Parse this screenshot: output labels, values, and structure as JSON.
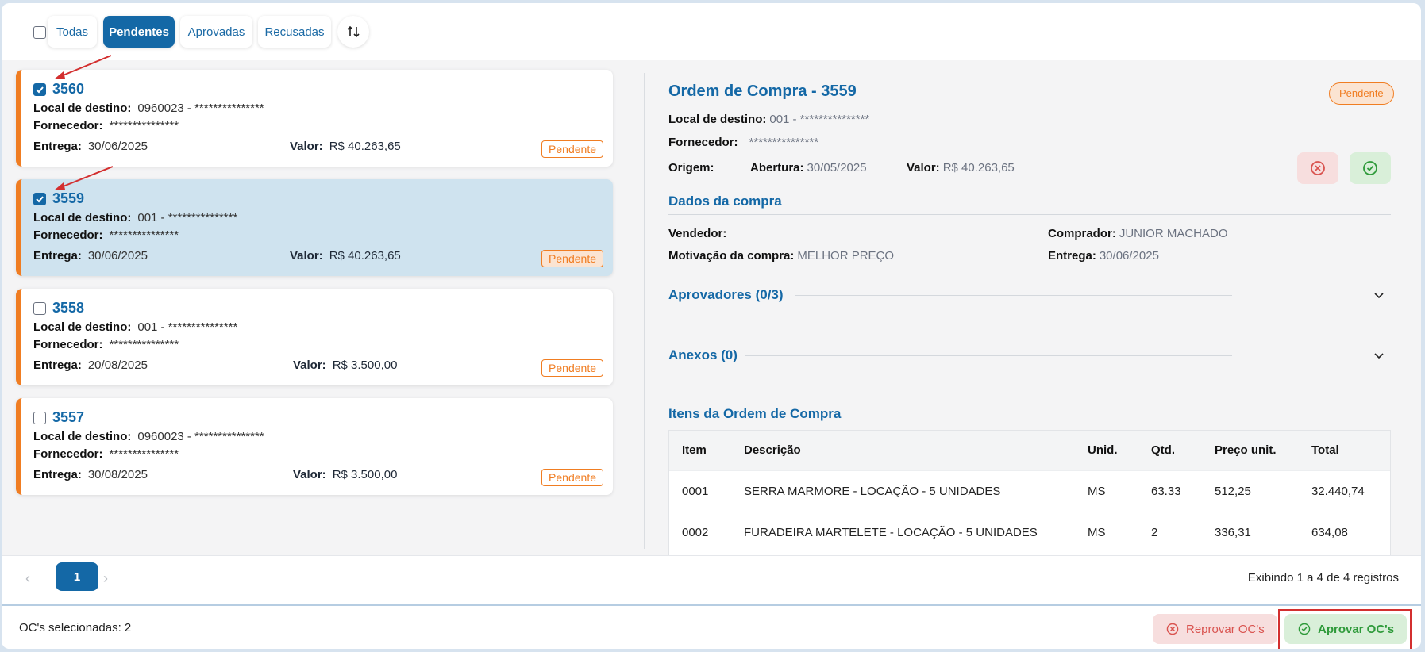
{
  "filters": {
    "tabs": [
      {
        "label": "Todas",
        "active": false
      },
      {
        "label": "Pendentes",
        "active": true
      },
      {
        "label": "Aprovadas",
        "active": false
      },
      {
        "label": "Recusadas",
        "active": false
      }
    ]
  },
  "cards": [
    {
      "number": "3560",
      "checked": true,
      "selected": false,
      "local_label": "Local de destino:",
      "local_value": "0960023 -  ***************",
      "fornecedor_label": "Fornecedor:",
      "fornecedor_value": "***************",
      "entrega_label": "Entrega:",
      "entrega_value": "30/06/2025",
      "valor_label": "Valor:",
      "valor_value": "R$ 40.263,65",
      "status": "Pendente"
    },
    {
      "number": "3559",
      "checked": true,
      "selected": true,
      "local_label": "Local de destino:",
      "local_value": "001 -  ***************",
      "fornecedor_label": "Fornecedor:",
      "fornecedor_value": "***************",
      "entrega_label": "Entrega:",
      "entrega_value": "30/06/2025",
      "valor_label": "Valor:",
      "valor_value": "R$ 40.263,65",
      "status": "Pendente"
    },
    {
      "number": "3558",
      "checked": false,
      "selected": false,
      "local_label": "Local de destino:",
      "local_value": "001 -  ***************",
      "fornecedor_label": "Fornecedor:",
      "fornecedor_value": "***************",
      "entrega_label": "Entrega:",
      "entrega_value": "20/08/2025",
      "valor_label": "Valor:",
      "valor_value": "R$ 3.500,00",
      "status": "Pendente"
    },
    {
      "number": "3557",
      "checked": false,
      "selected": false,
      "local_label": "Local de destino:",
      "local_value": "0960023 -  ***************",
      "fornecedor_label": "Fornecedor:",
      "fornecedor_value": "***************",
      "entrega_label": "Entrega:",
      "entrega_value": "30/08/2025",
      "valor_label": "Valor:",
      "valor_value": "R$ 3.500,00",
      "status": "Pendente"
    }
  ],
  "detail": {
    "title": "Ordem de Compra - 3559",
    "status": "Pendente",
    "local_label": "Local de destino:",
    "local_value": "001 -  ***************",
    "fornecedor_label": "Fornecedor:",
    "fornecedor_value": "***************",
    "origem_label": "Origem:",
    "abertura_label": "Abertura:",
    "abertura_value": "30/05/2025",
    "valor_label": "Valor:",
    "valor_value": "R$ 40.263,65",
    "dados_title": "Dados da compra",
    "vendedor_label": "Vendedor:",
    "vendedor_value": "",
    "comprador_label": "Comprador:",
    "comprador_value": "JUNIOR MACHADO",
    "motivacao_label": "Motivação da compra:",
    "motivacao_value": "MELHOR PREÇO",
    "entrega_label": "Entrega:",
    "entrega_value": "30/06/2025",
    "aprovadores_title": "Aprovadores (0/3)",
    "anexos_title": "Anexos (0)",
    "itens_title": "Itens da Ordem de Compra",
    "table": {
      "headers": [
        "Item",
        "Descrição",
        "Unid.",
        "Qtd.",
        "Preço unit.",
        "Total"
      ],
      "rows": [
        [
          "0001",
          "SERRA MARMORE - LOCAÇÃO - 5 UNIDADES",
          "MS",
          "63.33",
          "512,25",
          "32.440,74"
        ],
        [
          "0002",
          "FURADEIRA MARTELETE - LOCAÇÃO - 5 UNIDADES",
          "MS",
          "2",
          "336,31",
          "634,08"
        ]
      ]
    }
  },
  "pagination": {
    "current_page": "1",
    "info": "Exibindo 1 a 4 de 4 registros"
  },
  "bottom": {
    "selected_text": "OC's selecionadas: 2",
    "reject_label": "Reprovar OC's",
    "approve_label": "Aprovar OC's"
  },
  "colors": {
    "primary": "#1468a6",
    "pending": "#f07d22",
    "reject": "#d9534f",
    "approve": "#2e9a3a",
    "highlight": "#d32f2f"
  }
}
